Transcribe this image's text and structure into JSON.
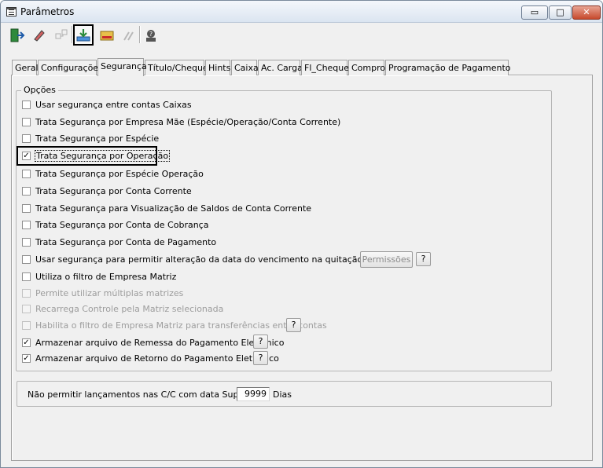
{
  "window": {
    "title": "Parâmetros",
    "minimize": "▭",
    "maximize": "□",
    "close": "✕"
  },
  "toolbar": {
    "items": [
      {
        "icon": "exit-door-icon",
        "glyph": "🚪"
      },
      {
        "icon": "eraser-icon",
        "glyph": "✎"
      },
      {
        "icon": "structure-icon",
        "glyph": "⧉"
      },
      {
        "icon": "save-icon",
        "glyph": "⬇"
      },
      {
        "icon": "open-folder-icon",
        "glyph": "📂"
      },
      {
        "icon": "tools-icon",
        "glyph": "⚒"
      },
      {
        "icon": "help-user-icon",
        "glyph": "?"
      }
    ]
  },
  "tabs": [
    "Geral",
    "Configurações",
    "Segurança",
    "Título/Cheque",
    "Hints",
    "Caixa",
    "Ac. Carga",
    "Fl_Cheque",
    "Compror",
    "Programação de Pagamento"
  ],
  "selected_tab": "Segurança",
  "options": {
    "legend": "Opções",
    "items": [
      {
        "label": "Usar segurança entre contas Caixas",
        "checked": false,
        "enabled": true
      },
      {
        "label": "Trata Segurança por Empresa Mãe (Espécie/Operação/Conta Corrente)",
        "checked": false,
        "enabled": true
      },
      {
        "label": "Trata Segurança por Espécie",
        "checked": false,
        "enabled": true
      },
      {
        "label": "Trata Segurança por Operação",
        "checked": true,
        "enabled": true
      },
      {
        "label": "Trata Segurança por Espécie Operação",
        "checked": false,
        "enabled": true
      },
      {
        "label": "Trata Segurança por Conta Corrente",
        "checked": false,
        "enabled": true
      },
      {
        "label": "Trata Segurança para Visualização de Saldos de Conta Corrente",
        "checked": false,
        "enabled": true
      },
      {
        "label": "Trata Segurança por Conta de Cobrança",
        "checked": false,
        "enabled": true
      },
      {
        "label": "Trata Segurança por Conta de Pagamento",
        "checked": false,
        "enabled": true
      },
      {
        "label": "Usar segurança para permitir alteração da data do vencimento na quitação de títulos",
        "checked": false,
        "enabled": true
      },
      {
        "label": "Utiliza o filtro de Empresa Matriz",
        "checked": false,
        "enabled": true
      },
      {
        "label": "Permite utilizar múltiplas matrizes",
        "checked": false,
        "enabled": false
      },
      {
        "label": "Recarrega Controle pela Matriz selecionada",
        "checked": false,
        "enabled": false
      },
      {
        "label": "Habilita o filtro de Empresa Matriz para transferências entre contas",
        "checked": false,
        "enabled": false
      },
      {
        "label": "Armazenar arquivo de Remessa do Pagamento Eletrônico",
        "checked": true,
        "enabled": true
      },
      {
        "label": "Armazenar arquivo de Retorno do Pagamento Eletrônico",
        "checked": true,
        "enabled": true
      }
    ],
    "permissions_button": "Permissões",
    "help_button": "?"
  },
  "bottom": {
    "label": "Não permitir lançamentos nas C/C com data Superior a",
    "value": "9999",
    "unit": "Dias"
  }
}
